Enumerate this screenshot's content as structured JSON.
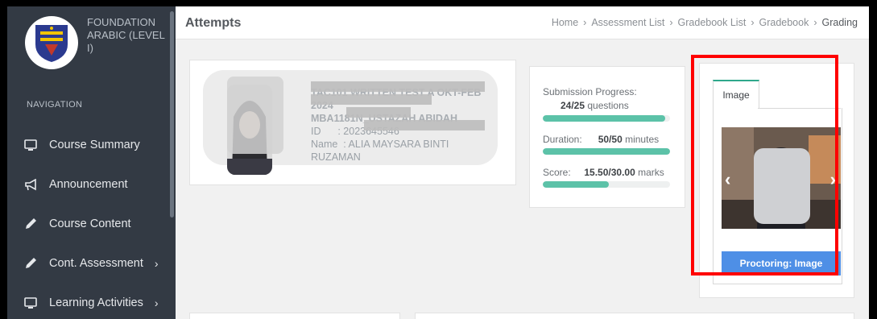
{
  "sidebar": {
    "school": "FOUNDATION ARABIC (LEVEL I)",
    "nav_header": "NAVIGATION",
    "items": [
      {
        "label": "Course Summary",
        "icon": "monitor-icon"
      },
      {
        "label": "Announcement",
        "icon": "megaphone-icon"
      },
      {
        "label": "Course Content",
        "icon": "pencil-icon"
      },
      {
        "label": "Cont. Assessment",
        "icon": "pencil-icon",
        "chevron": "›"
      },
      {
        "label": "Learning Activities",
        "icon": "monitor-icon",
        "chevron": "›"
      }
    ]
  },
  "header": {
    "title": "Attempts",
    "breadcrumbs": [
      "Home",
      "Assessment List",
      "Gradebook List",
      "Gradebook",
      "Grading"
    ],
    "separator": "›"
  },
  "profile": {
    "test_line": "TAC101 WRITTEN TEST A OKT-FEB 2024",
    "group_line": "MBA1181N_USTAZAH ABIDAH",
    "id_label": "ID",
    "id_value": ": 2023645546",
    "name_label": "Name",
    "name_value": ": ALIA MAYSARA BINTI RUZAMAN"
  },
  "progress": {
    "submission_label": "Submission Progress:",
    "submission_value": "24/25",
    "submission_unit": "questions",
    "submission_fraction": 0.96,
    "duration_label": "Duration:",
    "duration_value": "50/50",
    "duration_unit": "minutes",
    "duration_fraction": 1.0,
    "score_label": "Score:",
    "score_value": "15.50/30.00",
    "score_unit": "marks",
    "score_fraction": 0.5167
  },
  "image_panel": {
    "tab_label": "Image",
    "prev_arrow": "‹",
    "next_arrow": "›",
    "button_label": "Proctoring: Image"
  },
  "colors": {
    "sidebar_bg": "#333a44",
    "progress_fill": "#5cc2a8",
    "button_blue": "#4e8fe6",
    "highlight_red": "#ff0000"
  }
}
